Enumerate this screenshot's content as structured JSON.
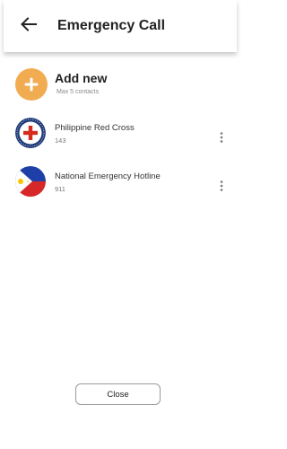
{
  "header": {
    "title": "Emergency Call",
    "back_icon": "arrow-left-icon"
  },
  "add_new": {
    "label": "Add new",
    "subtitle": "Max 5 contacts",
    "icon": "plus-icon",
    "color": "#f1ac52"
  },
  "contacts": [
    {
      "name": "Philippine Red Cross",
      "number": "143",
      "avatar": "philippine-red-cross-logo",
      "menu_icon": "more-vertical-icon"
    },
    {
      "name": "National Emergency Hotline",
      "number": "911",
      "avatar": "philippine-flag-logo",
      "menu_icon": "more-vertical-icon"
    }
  ],
  "footer": {
    "close_label": "Close"
  },
  "colors": {
    "red_cross": "#d52b1e",
    "flag_blue": "#1f3fa8",
    "flag_red": "#d62828",
    "flag_sun": "#f6c500"
  }
}
